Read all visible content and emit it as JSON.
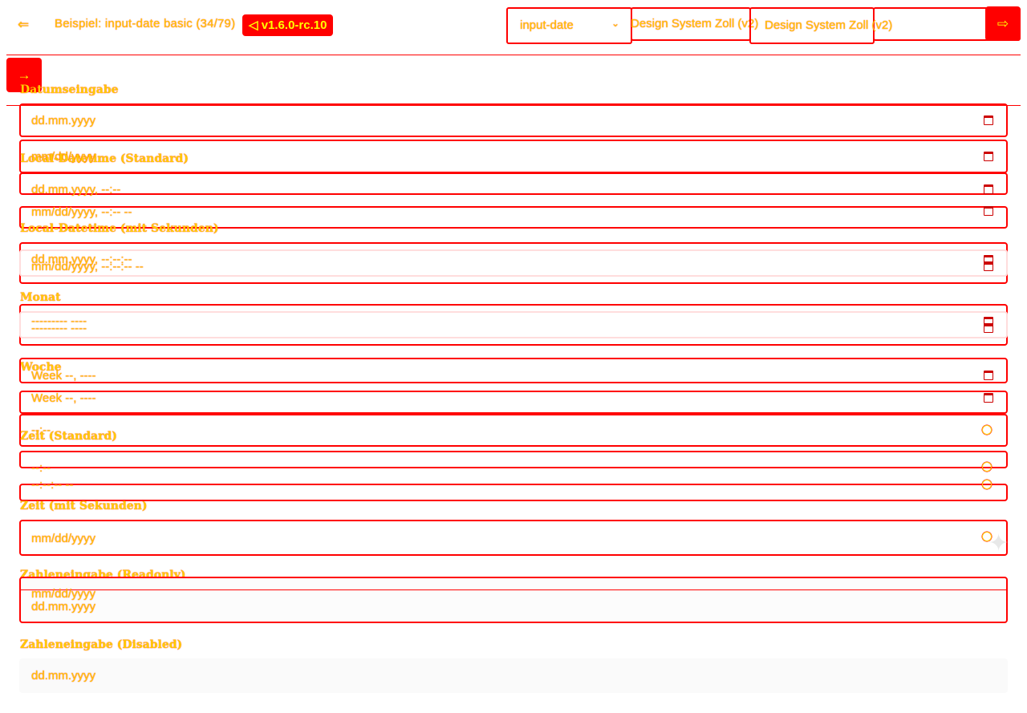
{
  "header": {
    "back_icon": "arrow-left-icon",
    "breadcrumb": "Beispiel: input-date basic (34/79)",
    "version_badge": "◁ v1.6.0-rc.10",
    "component_select": "input-date",
    "theme_select_1": "Design System Zoll (v2)",
    "theme_select_2": "Design System Zoll (v2)",
    "go_icon": "arrow-right-icon"
  },
  "sidebar": {
    "toggle_icon": "arrow-right-icon"
  },
  "form": {
    "date": {
      "label": "Datumseingabe",
      "placeholder": "dd.mm.yyyy"
    },
    "datetime": {
      "label": "Local-Datetime (Standard)",
      "placeholder_1": "mm/dd/yyyy",
      "placeholder_2": "dd.mm.yyyy, --:--",
      "placeholder_3": "mm/dd/yyyy, --:-- --"
    },
    "datetime_seconds": {
      "label": "Local-Datetime (mit Sekunden)",
      "placeholder_1": "dd.mm.yyyy, --:--:--",
      "placeholder_2": "mm/dd/yyyy, --:--:-- --"
    },
    "month": {
      "label": "Monat",
      "placeholder_1": "--------- ----",
      "placeholder_2": "--------- ----"
    },
    "week": {
      "label": "Woche",
      "placeholder_1": "Week --, ----",
      "placeholder_2": "Week --, ----"
    },
    "time": {
      "label": "Zeit (Standard)",
      "placeholder_1": "--:--",
      "placeholder_2": "--:--",
      "placeholder_3": "--:--:-- --"
    },
    "time_seconds": {
      "label": "Zeit (mit Sekunden)",
      "placeholder": "mm/dd/yyyy"
    },
    "readonly": {
      "label": "Zahleneingabe (Readonly)",
      "placeholder_1": "mm/dd/yyyy",
      "placeholder_2": "dd.mm.yyyy"
    },
    "disabled": {
      "label": "Zahleneingabe (Disabled)",
      "placeholder": "dd.mm.yyyy"
    }
  },
  "colors": {
    "outline": "#ff0000",
    "text": "#ffcc00",
    "badge_bg": "#ff0000",
    "badge_text": "#ffff00"
  }
}
